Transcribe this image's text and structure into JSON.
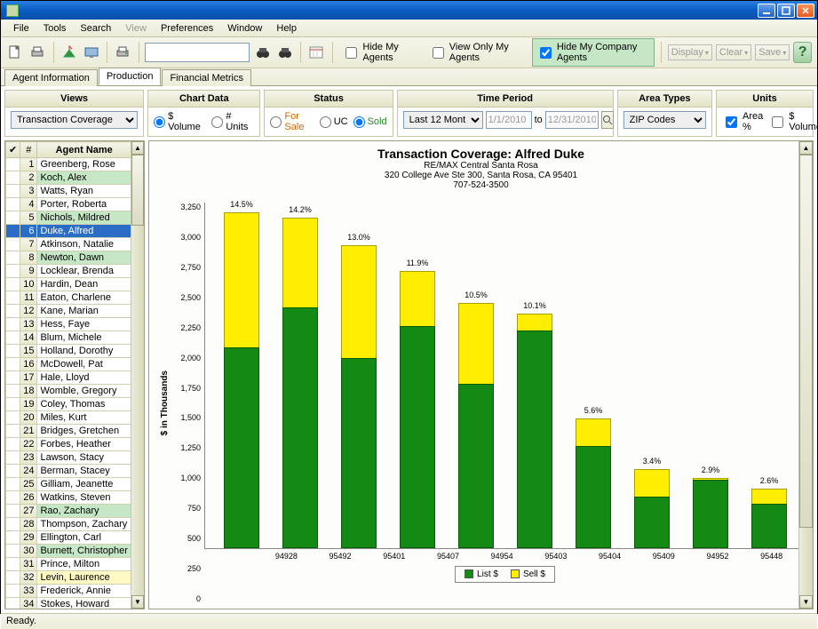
{
  "window": {
    "title": ""
  },
  "menu": {
    "file": "File",
    "tools": "Tools",
    "search": "Search",
    "view": "View",
    "preferences": "Preferences",
    "window": "Window",
    "help": "Help"
  },
  "toolbar": {
    "search_placeholder": "",
    "chk_hide_my": "Hide My Agents",
    "chk_view_only": "View Only My Agents",
    "chk_hide_company": "Hide My Company Agents",
    "btn_display": "Display",
    "btn_clear": "Clear",
    "btn_save": "Save"
  },
  "tabs": {
    "agent_info": "Agent Information",
    "production": "Production",
    "financial": "Financial Metrics",
    "active": "production"
  },
  "panels": {
    "views": {
      "title": "Views",
      "selected": "Transaction Coverage"
    },
    "chart_data": {
      "title": "Chart Data",
      "opt_volume": "$ Volume",
      "opt_units": "# Units",
      "selected": "$ Volume"
    },
    "status": {
      "title": "Status",
      "opt_forsale": "For Sale",
      "opt_uc": "UC",
      "opt_sold": "Sold",
      "selected": "Sold"
    },
    "time": {
      "title": "Time Period",
      "selected": "Last 12 Mont...",
      "from": "1/1/2010",
      "to_label": "to",
      "to": "12/31/2010"
    },
    "area": {
      "title": "Area Types",
      "selected": "ZIP Codes"
    },
    "units": {
      "title": "Units",
      "chk_area": "Area %",
      "chk_volume": "$ Volume",
      "area_checked": true,
      "volume_checked": false
    }
  },
  "agents": {
    "header_num": "#",
    "header_name": "Agent Name",
    "rows": [
      {
        "n": 1,
        "name": "Greenberg, Rose",
        "cls": ""
      },
      {
        "n": 2,
        "name": "Koch, Alex",
        "cls": "hl-green"
      },
      {
        "n": 3,
        "name": "Watts, Ryan",
        "cls": ""
      },
      {
        "n": 4,
        "name": "Porter, Roberta",
        "cls": ""
      },
      {
        "n": 5,
        "name": "Nichols, Mildred",
        "cls": "hl-green"
      },
      {
        "n": 6,
        "name": "Duke, Alfred",
        "cls": "sel"
      },
      {
        "n": 7,
        "name": "Atkinson, Natalie",
        "cls": ""
      },
      {
        "n": 8,
        "name": "Newton, Dawn",
        "cls": "hl-green"
      },
      {
        "n": 9,
        "name": "Locklear, Brenda",
        "cls": ""
      },
      {
        "n": 10,
        "name": "Hardin, Dean",
        "cls": ""
      },
      {
        "n": 11,
        "name": "Eaton, Charlene",
        "cls": ""
      },
      {
        "n": 12,
        "name": "Kane, Marian",
        "cls": ""
      },
      {
        "n": 13,
        "name": "Hess, Faye",
        "cls": ""
      },
      {
        "n": 14,
        "name": "Blum, Michele",
        "cls": ""
      },
      {
        "n": 15,
        "name": "Holland, Dorothy",
        "cls": ""
      },
      {
        "n": 16,
        "name": "McDowell, Pat",
        "cls": ""
      },
      {
        "n": 17,
        "name": "Hale, Lloyd",
        "cls": ""
      },
      {
        "n": 18,
        "name": "Womble, Gregory",
        "cls": ""
      },
      {
        "n": 19,
        "name": "Coley, Thomas",
        "cls": ""
      },
      {
        "n": 20,
        "name": "Miles, Kurt",
        "cls": ""
      },
      {
        "n": 21,
        "name": "Bridges, Gretchen",
        "cls": ""
      },
      {
        "n": 22,
        "name": "Forbes, Heather",
        "cls": ""
      },
      {
        "n": 23,
        "name": "Lawson, Stacy",
        "cls": ""
      },
      {
        "n": 24,
        "name": "Berman, Stacey",
        "cls": ""
      },
      {
        "n": 25,
        "name": "Gilliam, Jeanette",
        "cls": ""
      },
      {
        "n": 26,
        "name": "Watkins, Steven",
        "cls": ""
      },
      {
        "n": 27,
        "name": "Rao, Zachary",
        "cls": "hl-green"
      },
      {
        "n": 28,
        "name": "Thompson, Zachary",
        "cls": ""
      },
      {
        "n": 29,
        "name": "Ellington, Carl",
        "cls": ""
      },
      {
        "n": 30,
        "name": "Burnett, Christopher",
        "cls": "hl-green"
      },
      {
        "n": 31,
        "name": "Prince, Milton",
        "cls": ""
      },
      {
        "n": 32,
        "name": "Levin, Laurence",
        "cls": "hl-yellow"
      },
      {
        "n": 33,
        "name": "Frederick, Annie",
        "cls": ""
      },
      {
        "n": 34,
        "name": "Stokes, Howard",
        "cls": ""
      }
    ]
  },
  "chart": {
    "title": "Transaction Coverage: Alfred Duke",
    "sub1": "RE/MAX Central Santa Rosa",
    "sub2": "320 College Ave Ste 300, Santa Rosa, CA 95401",
    "sub3": "707-524-3500",
    "ylabel": "$ in Thousands",
    "legend_list": "List $",
    "legend_sell": "Sell $"
  },
  "chart_data": {
    "type": "bar",
    "stacked": true,
    "ylabel": "$ in Thousands",
    "ylim": [
      0,
      3250
    ],
    "yticks": [
      0,
      250,
      500,
      750,
      1000,
      1250,
      1500,
      1750,
      2000,
      2250,
      2500,
      2750,
      3000,
      3250
    ],
    "categories": [
      "94928",
      "95492",
      "95401",
      "95407",
      "94954",
      "95403",
      "95404",
      "95409",
      "94952",
      "95448"
    ],
    "series": [
      {
        "name": "List $",
        "values": [
          1880,
          2260,
          1780,
          2080,
          1540,
          2040,
          960,
          480,
          640,
          420
        ]
      },
      {
        "name": "Sell $",
        "values": [
          1270,
          840,
          1060,
          520,
          760,
          160,
          260,
          260,
          20,
          140
        ]
      }
    ],
    "data_labels_pct": [
      "14.5%",
      "14.2%",
      "13.0%",
      "11.9%",
      "10.5%",
      "10.1%",
      "5.6%",
      "3.4%",
      "2.9%",
      "2.6%"
    ],
    "legend_position": "bottom"
  },
  "status": {
    "text": "Ready."
  }
}
